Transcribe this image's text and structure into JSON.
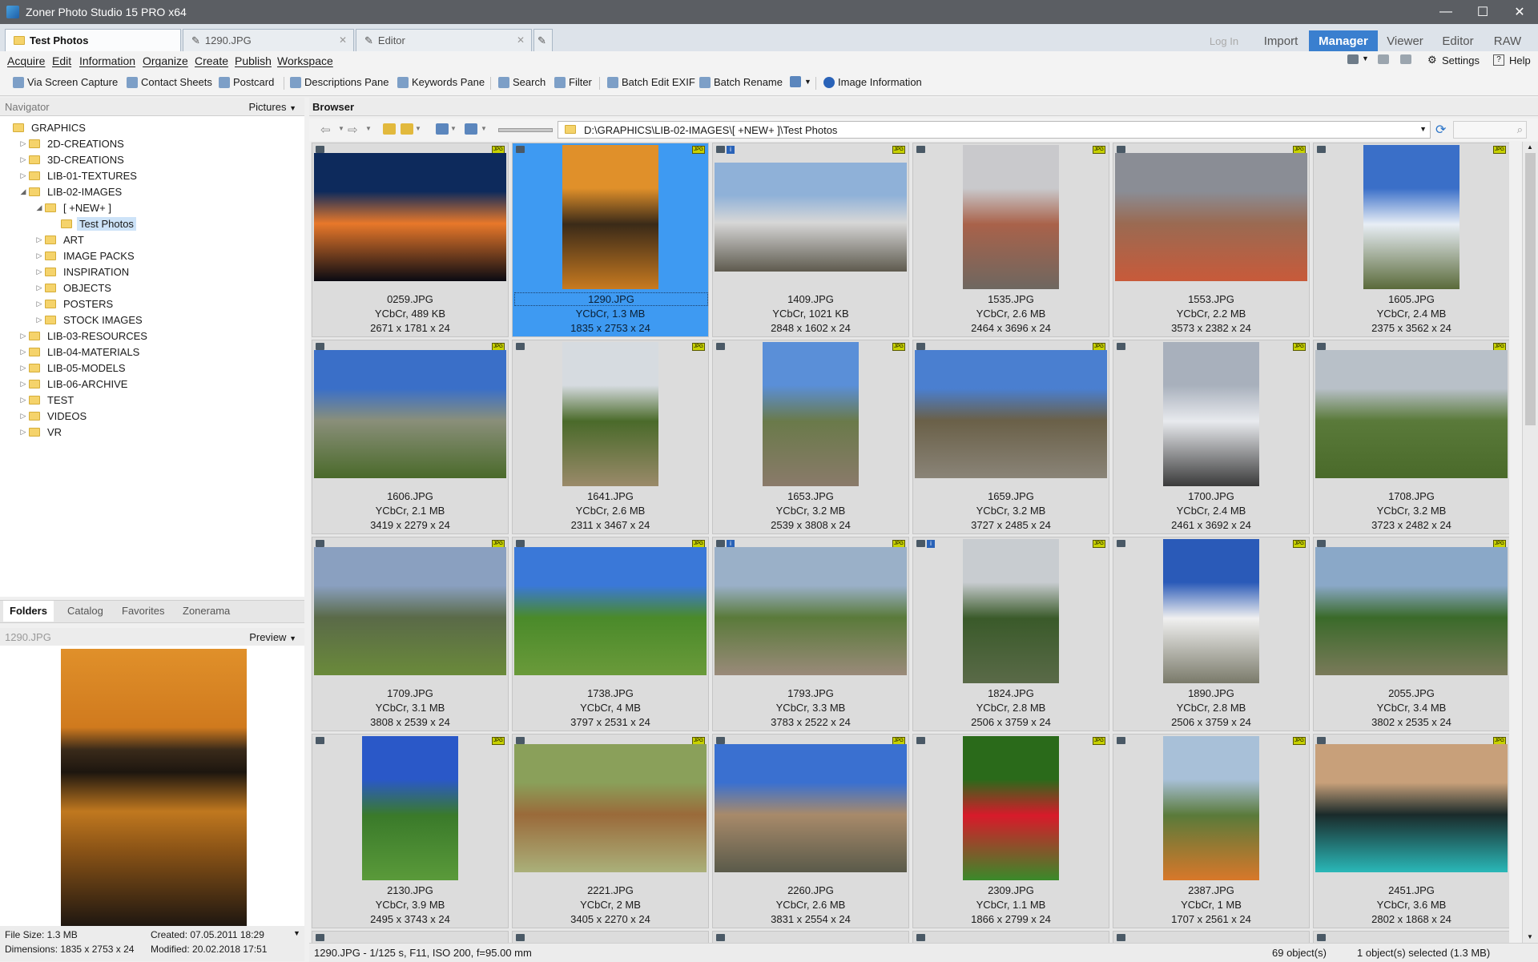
{
  "window": {
    "title": "Zoner Photo Studio 15 PRO x64"
  },
  "doc_tabs": [
    {
      "label": "Test Photos",
      "active": true
    },
    {
      "label": "1290.JPG",
      "active": false
    },
    {
      "label": "Editor",
      "active": false
    }
  ],
  "mode_tabs": [
    {
      "label": "Log In",
      "active": false
    },
    {
      "label": "Import",
      "active": false
    },
    {
      "label": "Manager",
      "active": true
    },
    {
      "label": "Viewer",
      "active": false
    },
    {
      "label": "Editor",
      "active": false
    },
    {
      "label": "RAW",
      "active": false
    }
  ],
  "menu": [
    "Acquire",
    "Edit",
    "Information",
    "Organize",
    "Create",
    "Publish",
    "Workspace"
  ],
  "toolbar": {
    "buttons": [
      "Via Screen Capture",
      "Contact Sheets",
      "Postcard",
      "Descriptions Pane",
      "Keywords Pane",
      "Search",
      "Filter",
      "Batch Edit EXIF",
      "Batch Rename",
      "Image Information"
    ],
    "settings": "Settings",
    "help": "Help"
  },
  "navigator": {
    "title": "Navigator",
    "dropdown": "Pictures",
    "tree": [
      {
        "label": "GRAPHICS",
        "level": 0,
        "arrow": ""
      },
      {
        "label": "2D-CREATIONS",
        "level": 1,
        "arrow": "▷"
      },
      {
        "label": "3D-CREATIONS",
        "level": 1,
        "arrow": "▷"
      },
      {
        "label": "LIB-01-TEXTURES",
        "level": 1,
        "arrow": "▷"
      },
      {
        "label": "LIB-02-IMAGES",
        "level": 1,
        "arrow": "◢"
      },
      {
        "label": "[ +NEW+ ]",
        "level": 2,
        "arrow": "◢"
      },
      {
        "label": "Test Photos",
        "level": 3,
        "arrow": "",
        "selected": true
      },
      {
        "label": "ART",
        "level": 2,
        "arrow": "▷"
      },
      {
        "label": "IMAGE PACKS",
        "level": 2,
        "arrow": "▷"
      },
      {
        "label": "INSPIRATION",
        "level": 2,
        "arrow": "▷"
      },
      {
        "label": "OBJECTS",
        "level": 2,
        "arrow": "▷"
      },
      {
        "label": "POSTERS",
        "level": 2,
        "arrow": "▷"
      },
      {
        "label": "STOCK IMAGES",
        "level": 2,
        "arrow": "▷"
      },
      {
        "label": "LIB-03-RESOURCES",
        "level": 1,
        "arrow": "▷"
      },
      {
        "label": "LIB-04-MATERIALS",
        "level": 1,
        "arrow": "▷"
      },
      {
        "label": "LIB-05-MODELS",
        "level": 1,
        "arrow": "▷"
      },
      {
        "label": "LIB-06-ARCHIVE",
        "level": 1,
        "arrow": "▷"
      },
      {
        "label": "TEST",
        "level": 1,
        "arrow": "▷"
      },
      {
        "label": "VIDEOS",
        "level": 1,
        "arrow": "▷"
      },
      {
        "label": "VR",
        "level": 1,
        "arrow": "▷"
      }
    ]
  },
  "left_tabs": [
    "Folders",
    "Catalog",
    "Favorites",
    "Zonerama"
  ],
  "preview": {
    "filename": "1290.JPG",
    "dropdown": "Preview",
    "file_size": "File Size: 1.3 MB",
    "created": "Created: 07.05.2011 18:29",
    "dimensions": "Dimensions: 1835 x 2753 x 24",
    "modified": "Modified: 20.02.2018 17:51"
  },
  "browser": {
    "title": "Browser",
    "path": "D:\\GRAPHICS\\LIB-02-IMAGES\\[ +NEW+ ]\\Test Photos",
    "items": [
      {
        "name": "0259.JPG",
        "type": "YCbCr, 489 KB",
        "dims": "2671 x 1781 x 24",
        "orient": "land",
        "colors": [
          "#0d2a5c",
          "#e8782a",
          "#0a0a12"
        ],
        "info": false
      },
      {
        "name": "1290.JPG",
        "type": "YCbCr, 1.3 MB",
        "dims": "1835 x 2753 x 24",
        "orient": "port",
        "colors": [
          "#e0902a",
          "#3a2a18",
          "#c87a20"
        ],
        "info": false,
        "selected": true
      },
      {
        "name": "1409.JPG",
        "type": "YCbCr, 1021 KB",
        "dims": "2848 x 1602 x 24",
        "orient": "land",
        "colors": [
          "#8fb1d8",
          "#d7d7d7",
          "#5e5a4e"
        ],
        "info": true
      },
      {
        "name": "1535.JPG",
        "type": "YCbCr, 2.6 MB",
        "dims": "2464 x 3696 x 24",
        "orient": "port",
        "colors": [
          "#c9c9cc",
          "#a9624a",
          "#6e6760"
        ],
        "info": false
      },
      {
        "name": "1553.JPG",
        "type": "YCbCr, 2.2 MB",
        "dims": "3573 x 2382 x 24",
        "orient": "land",
        "colors": [
          "#8a8d95",
          "#9a6a52",
          "#c85a3a"
        ],
        "info": false
      },
      {
        "name": "1605.JPG",
        "type": "YCbCr, 2.4 MB",
        "dims": "2375 x 3562 x 24",
        "orient": "port",
        "colors": [
          "#3a6fc8",
          "#e8eef5",
          "#5a6a3a"
        ],
        "info": false
      },
      {
        "name": "1606.JPG",
        "type": "YCbCr, 2.1 MB",
        "dims": "3419 x 2279 x 24",
        "orient": "land",
        "colors": [
          "#3a6fc8",
          "#8a8f7a",
          "#4a6a2a"
        ],
        "info": false
      },
      {
        "name": "1641.JPG",
        "type": "YCbCr, 2.6 MB",
        "dims": "2311 x 3467 x 24",
        "orient": "port",
        "colors": [
          "#d6dbe0",
          "#4a6a2a",
          "#9a8a6a"
        ],
        "info": false
      },
      {
        "name": "1653.JPG",
        "type": "YCbCr, 3.2 MB",
        "dims": "2539 x 3808 x 24",
        "orient": "port",
        "colors": [
          "#5a8fd8",
          "#6a7a4a",
          "#8a7a6a"
        ],
        "info": false
      },
      {
        "name": "1659.JPG",
        "type": "YCbCr, 3.2 MB",
        "dims": "3727 x 2485 x 24",
        "orient": "land",
        "colors": [
          "#4a7fd0",
          "#6a6048",
          "#8a8478"
        ],
        "info": false
      },
      {
        "name": "1700.JPG",
        "type": "YCbCr, 2.4 MB",
        "dims": "2461 x 3692 x 24",
        "orient": "port",
        "colors": [
          "#a8b0bc",
          "#e8eaee",
          "#3a3a3a"
        ],
        "info": false
      },
      {
        "name": "1708.JPG",
        "type": "YCbCr, 3.2 MB",
        "dims": "3723 x 2482 x 24",
        "orient": "land",
        "colors": [
          "#b8c0c8",
          "#5a7a3a",
          "#4a6a2a"
        ],
        "info": false
      },
      {
        "name": "1709.JPG",
        "type": "YCbCr, 3.1 MB",
        "dims": "3808 x 2539 x 24",
        "orient": "land",
        "colors": [
          "#8aa0c0",
          "#5a6a48",
          "#6a8a3a"
        ],
        "info": false
      },
      {
        "name": "1738.JPG",
        "type": "YCbCr, 4 MB",
        "dims": "3797 x 2531 x 24",
        "orient": "land",
        "colors": [
          "#3a78d8",
          "#4a8a2a",
          "#6a9a3a"
        ],
        "info": false
      },
      {
        "name": "1793.JPG",
        "type": "YCbCr, 3.3 MB",
        "dims": "3783 x 2522 x 24",
        "orient": "land",
        "colors": [
          "#9ab0c8",
          "#5a7a3a",
          "#9a8a7a"
        ],
        "info": true
      },
      {
        "name": "1824.JPG",
        "type": "YCbCr, 2.8 MB",
        "dims": "2506 x 3759 x 24",
        "orient": "port",
        "colors": [
          "#c8ccd0",
          "#3a5a2a",
          "#5a6a48"
        ],
        "info": true
      },
      {
        "name": "1890.JPG",
        "type": "YCbCr, 2.8 MB",
        "dims": "2506 x 3759 x 24",
        "orient": "port",
        "colors": [
          "#2a5ab8",
          "#f0f0f0",
          "#7a7a6a"
        ],
        "info": false
      },
      {
        "name": "2055.JPG",
        "type": "YCbCr, 3.4 MB",
        "dims": "3802 x 2535 x 24",
        "orient": "land",
        "colors": [
          "#8aa8c8",
          "#3a6a2a",
          "#7a7a5a"
        ],
        "info": false
      },
      {
        "name": "2130.JPG",
        "type": "YCbCr, 3.9 MB",
        "dims": "2495 x 3743 x 24",
        "orient": "port",
        "colors": [
          "#2a58c8",
          "#3a7a2a",
          "#5a9a3a"
        ],
        "info": false
      },
      {
        "name": "2221.JPG",
        "type": "YCbCr, 2 MB",
        "dims": "3405 x 2270 x 24",
        "orient": "land",
        "colors": [
          "#8aa05a",
          "#9a6a3a",
          "#aab07a"
        ],
        "info": false
      },
      {
        "name": "2260.JPG",
        "type": "YCbCr, 2.6 MB",
        "dims": "3831 x 2554 x 24",
        "orient": "land",
        "colors": [
          "#3a70d0",
          "#a88a6a",
          "#5a5a4a"
        ],
        "info": false
      },
      {
        "name": "2309.JPG",
        "type": "YCbCr, 1.1 MB",
        "dims": "1866 x 2799 x 24",
        "orient": "port",
        "colors": [
          "#2a6a1a",
          "#d81a2a",
          "#3a8a2a"
        ],
        "info": false
      },
      {
        "name": "2387.JPG",
        "type": "YCbCr, 1 MB",
        "dims": "1707 x 2561 x 24",
        "orient": "port",
        "colors": [
          "#a8c0d8",
          "#5a7a3a",
          "#d8782a"
        ],
        "info": false
      },
      {
        "name": "2451.JPG",
        "type": "YCbCr, 3.6 MB",
        "dims": "2802 x 1868 x 24",
        "orient": "land",
        "colors": [
          "#c8a07a",
          "#1a2a2a",
          "#2ab8b8"
        ],
        "info": false
      }
    ]
  },
  "status": {
    "exif": "1290.JPG - 1/125 s, F11, ISO 200, f=95.00 mm",
    "objects": "69 object(s)",
    "selection": "1 object(s) selected (1.3 MB)"
  },
  "colors": {
    "accent": "#3a7fcf",
    "selection": "#3e9af2",
    "titlebar": "#5b5e63"
  }
}
